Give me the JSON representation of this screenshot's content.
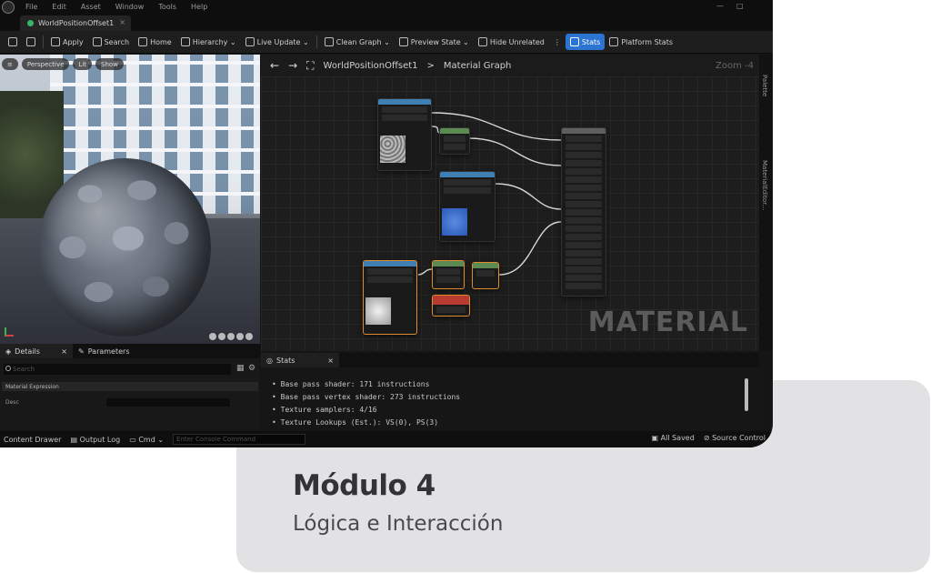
{
  "menu": [
    "File",
    "Edit",
    "Asset",
    "Window",
    "Tools",
    "Help"
  ],
  "document_tab": "WorldPositionOffset1",
  "toolbar": [
    {
      "label": "Apply",
      "icon": "apply-icon"
    },
    {
      "label": "Search",
      "icon": "search-icon"
    },
    {
      "label": "Home",
      "icon": "home-icon"
    },
    {
      "label": "Hierarchy ⌄",
      "icon": "hierarchy-icon"
    },
    {
      "label": "Live Update ⌄",
      "icon": "live-update-icon"
    },
    {
      "label": "Clean Graph ⌄",
      "icon": "clean-graph-icon"
    },
    {
      "label": "Preview State ⌄",
      "icon": "preview-state-icon"
    },
    {
      "label": "Hide Unrelated",
      "icon": "hide-unrelated-icon"
    },
    {
      "label": "Stats",
      "icon": "stats-icon"
    },
    {
      "label": "Platform Stats",
      "icon": "platform-stats-icon"
    }
  ],
  "viewport": {
    "perspective": "Perspective",
    "lit": "Lit",
    "show": "Show"
  },
  "graph": {
    "breadcrumb_root": "WorldPositionOffset1",
    "breadcrumb_separator": ">",
    "breadcrumb_leaf": "Material Graph",
    "zoom": "Zoom -4",
    "watermark": "MATERIAL"
  },
  "right_strip": {
    "palette": "Palette",
    "material_editor": "MaterialEditor..."
  },
  "details": {
    "tab_details": "Details",
    "tab_parameters": "Parameters",
    "search_placeholder": "Search",
    "section": "Material Expression",
    "prop_label": "Desc"
  },
  "stats": {
    "tab": "Stats",
    "lines": [
      "Base pass shader: 171 instructions",
      "Base pass vertex shader: 273 instructions",
      "Texture samplers: 4/16",
      "Texture Lookups (Est.): VS(0), PS(3)"
    ]
  },
  "statusbar": {
    "content_drawer": "Content Drawer",
    "output_log": "Output Log",
    "cmd": "Cmd ⌄",
    "cmd_placeholder": "Enter Console Command",
    "saved": "All Saved",
    "source_control": "Source Control"
  },
  "module": {
    "title": "Módulo 4",
    "subtitle": "Lógica e Interacción"
  },
  "colors": {
    "accent": "#2b74d2",
    "card": "#e2e1e3",
    "title": "#333337"
  }
}
